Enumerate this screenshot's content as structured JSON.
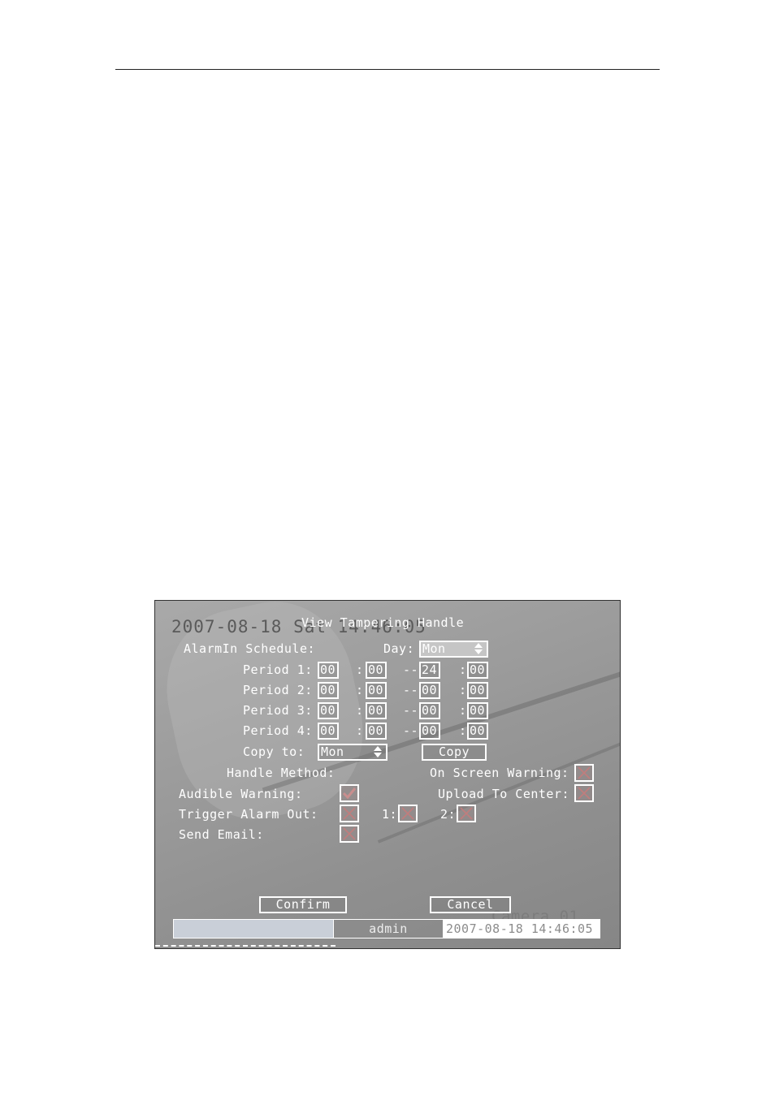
{
  "osd": {
    "datetime": "2007-08-18 Sat 14:46:05",
    "camera": "Camera 01"
  },
  "dialog": {
    "title": "View Tampering Handle",
    "alarmin_schedule_label": "AlarmIn Schedule:",
    "day_label": "Day:",
    "day_value": "Mon",
    "periods": [
      {
        "label": "Period 1:",
        "start_h": "00",
        "start_m": "00",
        "end_h": "24",
        "end_m": "00"
      },
      {
        "label": "Period 2:",
        "start_h": "00",
        "start_m": "00",
        "end_h": "00",
        "end_m": "00"
      },
      {
        "label": "Period 3:",
        "start_h": "00",
        "start_m": "00",
        "end_h": "00",
        "end_m": "00"
      },
      {
        "label": "Period 4:",
        "start_h": "00",
        "start_m": "00",
        "end_h": "00",
        "end_m": "00"
      }
    ],
    "time_colon": ":",
    "time_dash": "--",
    "copy_to_label": "Copy to:",
    "copy_to_value": "Mon",
    "copy_button": "Copy",
    "handle_method_label": "Handle Method:",
    "on_screen_warning_label": "On Screen Warning:",
    "on_screen_warning_checked": false,
    "audible_warning_label": "Audible Warning:",
    "audible_warning_checked": true,
    "upload_to_center_label": "Upload To Center:",
    "upload_to_center_checked": false,
    "trigger_alarm_out_label": "Trigger Alarm Out:",
    "trigger_alarm_out_checked": false,
    "alarm_out_1_label": "1:",
    "alarm_out_1_checked": false,
    "alarm_out_2_label": "2:",
    "alarm_out_2_checked": false,
    "send_email_label": "Send Email:",
    "send_email_checked": false,
    "confirm_button": "Confirm",
    "cancel_button": "Cancel"
  },
  "status_bar": {
    "user": "admin",
    "datetime": "2007-08-18 14:46:05"
  },
  "colors": {
    "check_mark": "#c98e8e",
    "cross_mark": "#c07d7d"
  }
}
